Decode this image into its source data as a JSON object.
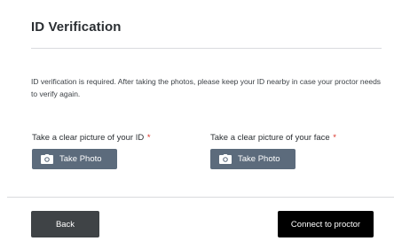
{
  "header": {
    "title": "ID Verification"
  },
  "notice": {
    "text": "ID verification is required. After taking the photos, please keep your ID nearby in case your proctor needs to verify again."
  },
  "fields": {
    "id_photo": {
      "label": "Take a clear picture of your ID",
      "required_marker": "*",
      "button_label": "Take Photo",
      "button_icon": "camera-icon"
    },
    "face_photo": {
      "label": "Take a clear picture of your face",
      "required_marker": "*",
      "button_label": "Take Photo",
      "button_icon": "camera-icon"
    }
  },
  "footer": {
    "back_label": "Back",
    "connect_label": "Connect to proctor"
  },
  "colors": {
    "photo_button": "#5c6b7c",
    "back_button": "#3f4346",
    "connect_button": "#000000",
    "required_marker": "#d93025"
  }
}
